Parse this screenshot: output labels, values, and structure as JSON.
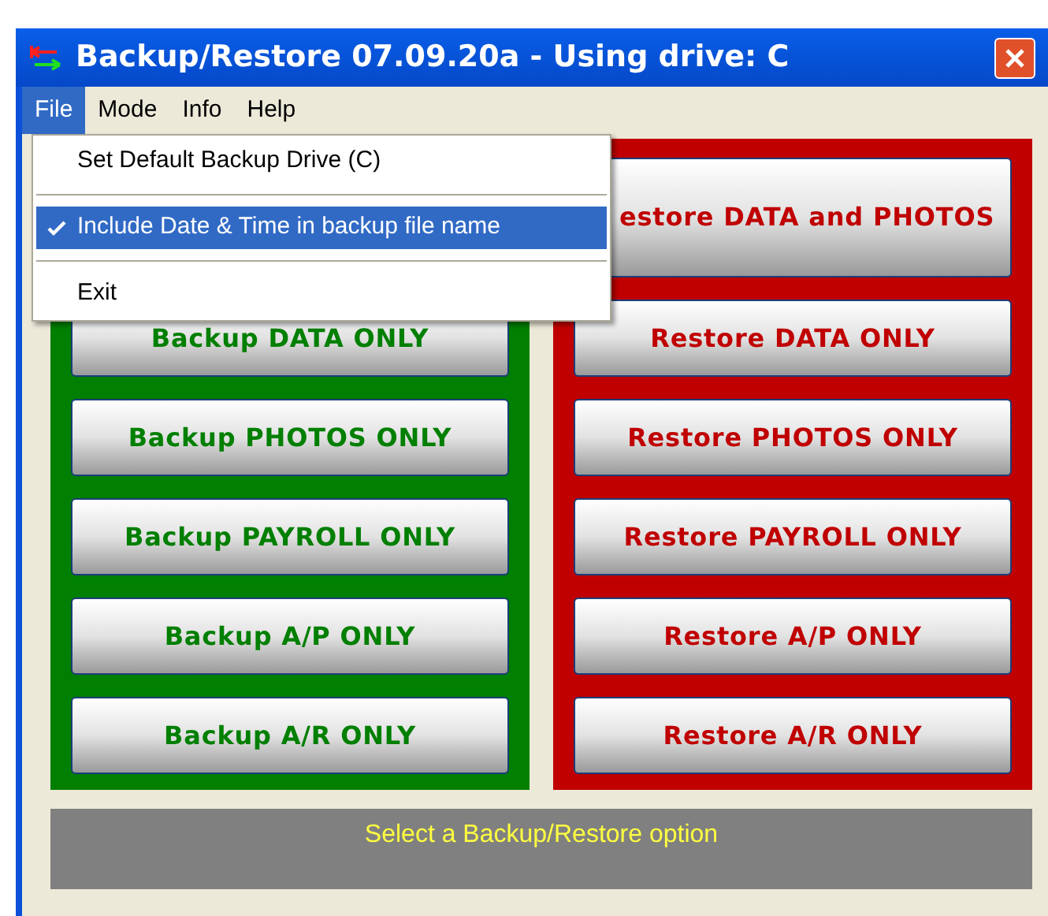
{
  "window": {
    "title": "Backup/Restore 07.09.20a - Using drive: C"
  },
  "menu_bar": [
    {
      "label": "File",
      "selected": true
    },
    {
      "label": "Mode",
      "selected": false
    },
    {
      "label": "Info",
      "selected": false
    },
    {
      "label": "Help",
      "selected": false
    }
  ],
  "file_menu": [
    {
      "kind": "item",
      "label": "Set Default Backup Drive (C)",
      "checked": false,
      "highlighted": false
    },
    {
      "kind": "separator"
    },
    {
      "kind": "item",
      "label": "Include Date & Time in backup file name",
      "checked": true,
      "highlighted": true
    },
    {
      "kind": "separator"
    },
    {
      "kind": "item",
      "label": "Exit",
      "checked": false,
      "highlighted": false
    }
  ],
  "panels": [
    {
      "color": "#007f00",
      "buttons": [
        "Backup DATA ONLY",
        "Backup PHOTOS ONLY",
        "Backup PAYROLL ONLY",
        "Backup A/P ONLY",
        "Backup A/R ONLY"
      ]
    },
    {
      "color": "#c00000",
      "top_button": "estore DATA and PHOTOS",
      "buttons": [
        "Restore DATA ONLY",
        "Restore PHOTOS ONLY",
        "Restore PAYROLL ONLY",
        "Restore A/P ONLY",
        "Restore A/R ONLY"
      ]
    }
  ],
  "status": "Select a Backup/Restore option"
}
